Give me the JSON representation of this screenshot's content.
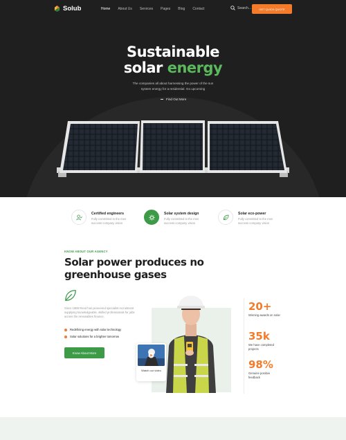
{
  "brand": {
    "name": "Solub",
    "accent": "#f47b2a",
    "green": "#3d9a47"
  },
  "nav": {
    "items": [
      "Home",
      "About Us",
      "Services",
      "Pages",
      "Blog",
      "Contact"
    ],
    "active": "Home",
    "search_label": "Search...",
    "cta_label": "GET QUICK QUOTE"
  },
  "hero": {
    "title_line1": "Sustainable",
    "title_line2_a": "solar ",
    "title_line2_b": "energy",
    "subtitle": "The companies all about harnessing the power of the sun system energy for a residential. Go upcoming",
    "link_label": "Find Out More"
  },
  "features": [
    {
      "title": "Certified engineers",
      "desc": "Fully committed to the men success company vision",
      "icon": "user-check-icon"
    },
    {
      "title": "Solar system design",
      "desc": "Fully committed to the men success company vision",
      "icon": "gear-icon"
    },
    {
      "title": "Solar eco-power",
      "desc": "Fully committed to the men success company vision",
      "icon": "leaf-icon"
    }
  ],
  "about": {
    "kicker": "KNOW ABOUT OUR AGENCY",
    "title": "Solar power produces no greenhouse gases",
    "description": "Since 1988 Reed has pioneered specialist recruitment supplying knowledgeable, skilled professionals for jobs across the renewables finance.",
    "bullets": [
      "Redefining energy with solar technology",
      "Solar solutions for a brighter tomorrow"
    ],
    "button_label": "Know About More",
    "video_label": "Watch our video"
  },
  "stats": [
    {
      "value": "20+",
      "label": "Winning awards on solar"
    },
    {
      "value": "35k",
      "label": "We have completed projects"
    },
    {
      "value": "98%",
      "label": "Genuine positive feedback"
    }
  ]
}
